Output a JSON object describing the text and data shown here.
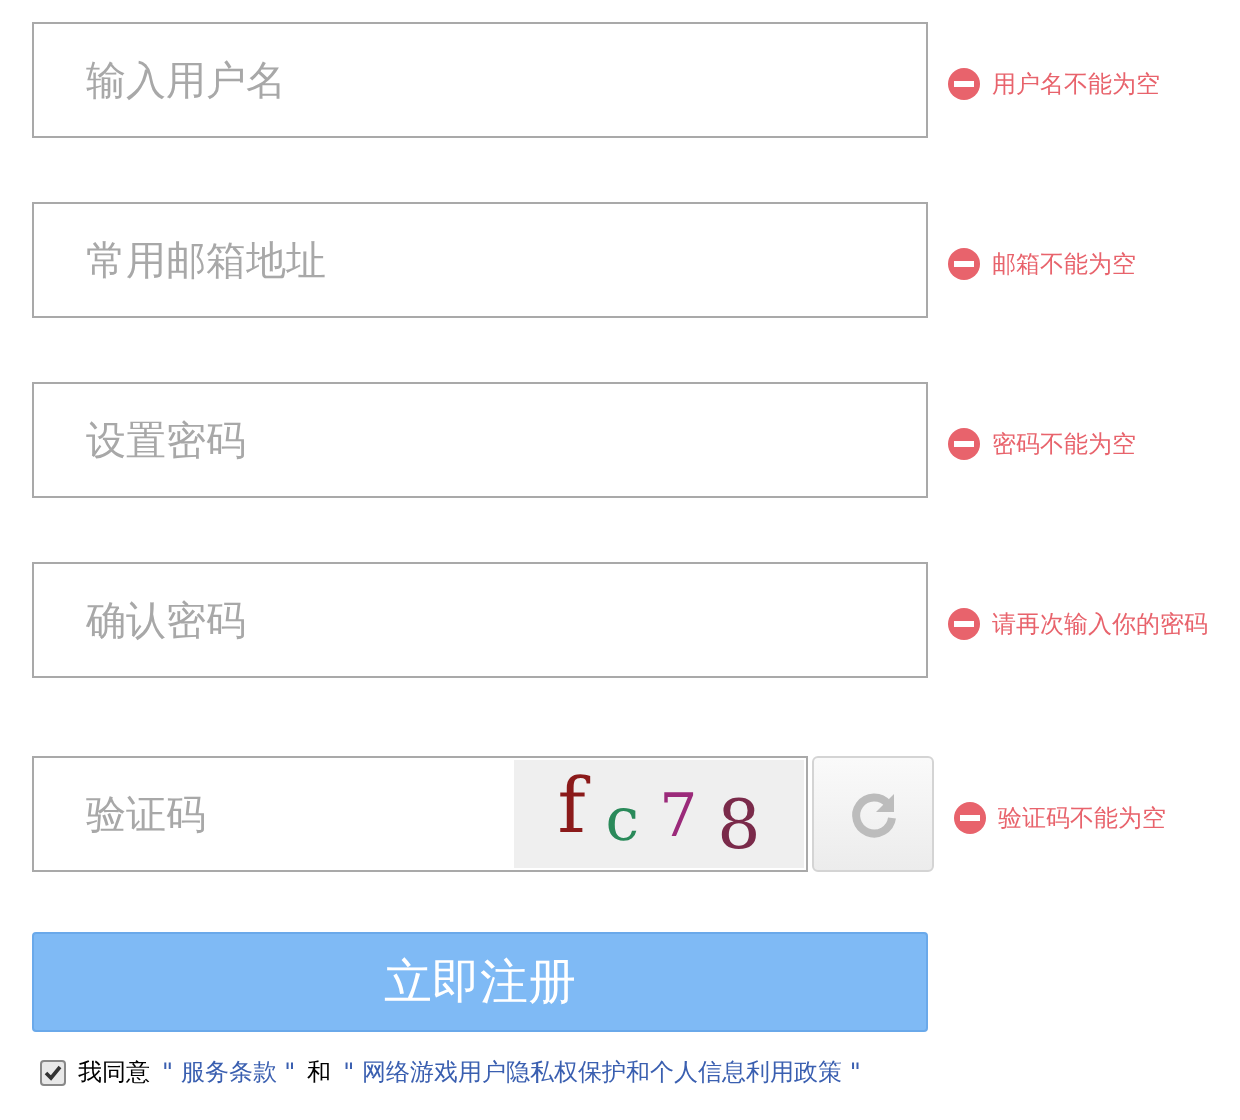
{
  "fields": [
    {
      "placeholder": "输入用户名",
      "error": "用户名不能为空"
    },
    {
      "placeholder": "常用邮箱地址",
      "error": "邮箱不能为空"
    },
    {
      "placeholder": "设置密码",
      "error": "密码不能为空"
    },
    {
      "placeholder": "确认密码",
      "error": "请再次输入你的密码"
    }
  ],
  "captcha": {
    "placeholder": "验证码",
    "error": "验证码不能为空",
    "chars": [
      {
        "text": "f",
        "color": "#8b1a1a"
      },
      {
        "text": "c",
        "color": "#2a8a5a"
      },
      {
        "text": "7",
        "color": "#9b2a7a"
      },
      {
        "text": "8",
        "color": "#7a2a4a"
      }
    ]
  },
  "submit": "立即注册",
  "agreement": {
    "checked": true,
    "parts": [
      {
        "kind": "text",
        "text": "我同意"
      },
      {
        "kind": "link",
        "text": "\" 服务条款 \""
      },
      {
        "kind": "text",
        "text": "和"
      },
      {
        "kind": "link",
        "text": "\" 网络游戏用户隐私权保护和个人信息利用政策 \""
      }
    ]
  }
}
